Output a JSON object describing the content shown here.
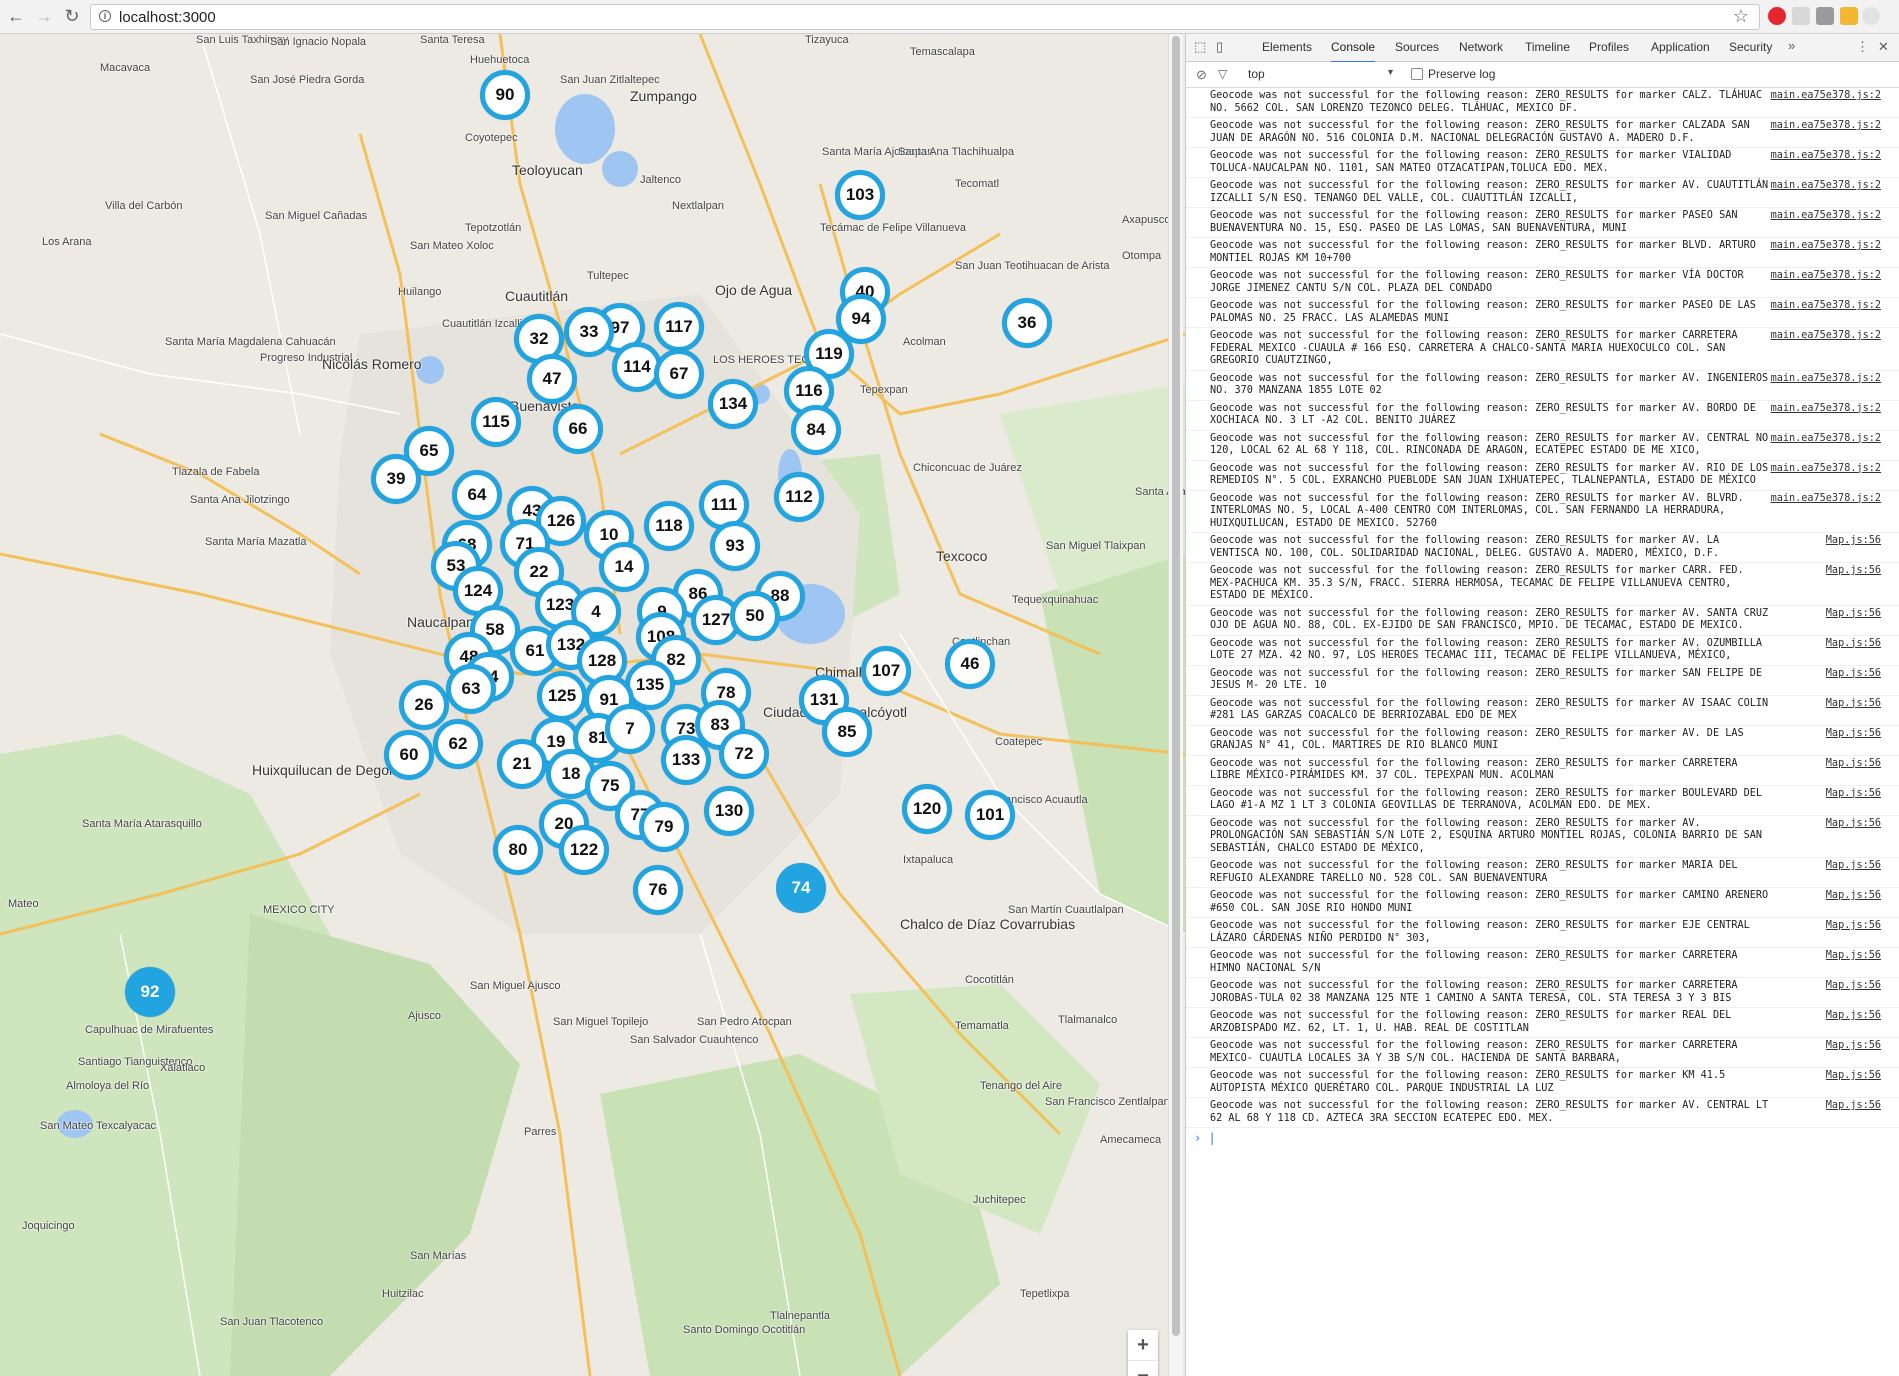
{
  "browser": {
    "url": "localhost:3000",
    "back_icon": "←",
    "forward_icon": "→",
    "reload_icon": "↻",
    "info_icon": "i",
    "star_icon": "☆"
  },
  "map": {
    "places": [
      {
        "t": "Santa Teresa"
      },
      {
        "t": "San Luis Taxhimay"
      },
      {
        "t": "San Ignacio Nopala"
      },
      {
        "t": "Huehuetoca"
      },
      {
        "t": "Tizayuca"
      },
      {
        "t": "Temascalapa"
      },
      {
        "t": "Macavaca"
      },
      {
        "t": "San José Piedra Gorda"
      },
      {
        "t": "San Juan Zitlaltepec"
      },
      {
        "t": "Zumpango"
      },
      {
        "t": "Coyotepec"
      },
      {
        "t": "Teoloyucan"
      },
      {
        "t": "Jaltenco"
      },
      {
        "t": "Nextlalpan"
      },
      {
        "t": "Santa María Ajoloapan"
      },
      {
        "t": "Santa Ana Tlachihualpa"
      },
      {
        "t": "Tecomatl"
      },
      {
        "t": "Villa del Carbón"
      },
      {
        "t": "San Miguel Cañadas"
      },
      {
        "t": "Tepotzotlán"
      },
      {
        "t": "Tecámac de Felipe Villanueva"
      },
      {
        "t": "Los Arana"
      },
      {
        "t": "San Mateo Xoloc"
      },
      {
        "t": "Tultepec"
      },
      {
        "t": "Ojo de Agua"
      },
      {
        "t": "San Juan Teotihuacan de Arista"
      },
      {
        "t": "Huilango"
      },
      {
        "t": "Cuautitlán"
      },
      {
        "t": "Cuautitlán Izcalli"
      },
      {
        "t": "LOS HEROES TECAMAC"
      },
      {
        "t": "Acolman"
      },
      {
        "t": "Santa María Magdalena Cahuacán"
      },
      {
        "t": "Progreso Industrial"
      },
      {
        "t": "Nicolás Romero"
      },
      {
        "t": "Buenavista"
      },
      {
        "t": "Tepexpan"
      },
      {
        "t": "Chiconcuac de Juárez"
      },
      {
        "t": "Tlazala de Fabela"
      },
      {
        "t": "Santa Ana Jilotzingo"
      },
      {
        "t": "Santa María Mazatla"
      },
      {
        "t": "Texcoco"
      },
      {
        "t": "San Miguel Tlaixpan"
      },
      {
        "t": "Tequexquinahuac"
      },
      {
        "t": "Naucalpan"
      },
      {
        "t": "Coatlinchan"
      },
      {
        "t": "Chimalhuacan"
      },
      {
        "t": "Ciudad Nezahualcóyotl"
      },
      {
        "t": "Coatepec"
      },
      {
        "t": "Huixquilucan de Degollado"
      },
      {
        "t": "San Francisco Acuautla"
      },
      {
        "t": "Santa María Atarasquillo"
      },
      {
        "t": "Ixtapaluca"
      },
      {
        "t": "Chalco de Díaz Covarrubias"
      },
      {
        "t": "San Martín Cuautlalpan"
      },
      {
        "t": "Cocotitlán"
      },
      {
        "t": "San Miguel Ajusco"
      },
      {
        "t": "Ajusco"
      },
      {
        "t": "San Miguel Topilejo"
      },
      {
        "t": "San Pedro Atocpan"
      },
      {
        "t": "San Salvador Cuauhtenco"
      },
      {
        "t": "Temamatla"
      },
      {
        "t": "Tlalmanalco"
      },
      {
        "t": "Capulhuac de Mirafuentes"
      },
      {
        "t": "Santiago Tianguistenco"
      },
      {
        "t": "Xalatlaco"
      },
      {
        "t": "Almoloya del Río"
      },
      {
        "t": "San Mateo Texcalyacac"
      },
      {
        "t": "Tenango del Aire"
      },
      {
        "t": "San Francisco Zentlalpan"
      },
      {
        "t": "Amecameca"
      },
      {
        "t": "Parres"
      },
      {
        "t": "Juchitepec"
      },
      {
        "t": "Joquicingo"
      },
      {
        "t": "San Marías"
      },
      {
        "t": "Huitzilac"
      },
      {
        "t": "Tlalnepantla"
      },
      {
        "t": "San Juan Tlacotenco"
      },
      {
        "t": "Santo Domingo Ocotitlán"
      },
      {
        "t": "Tepetlixpa"
      },
      {
        "t": "MEXICO CITY"
      },
      {
        "t": "Mateo"
      },
      {
        "t": "Santa Ana Apipil"
      },
      {
        "t": "Axapusco"
      },
      {
        "t": "Otompa"
      }
    ],
    "clusters": [
      {
        "n": "90"
      },
      {
        "n": "103"
      },
      {
        "n": "40"
      },
      {
        "n": "94"
      },
      {
        "n": "36"
      },
      {
        "n": "32"
      },
      {
        "n": "97"
      },
      {
        "n": "33"
      },
      {
        "n": "117"
      },
      {
        "n": "119"
      },
      {
        "n": "47"
      },
      {
        "n": "114"
      },
      {
        "n": "67"
      },
      {
        "n": "116"
      },
      {
        "n": "134"
      },
      {
        "n": "84"
      },
      {
        "n": "115"
      },
      {
        "n": "66"
      },
      {
        "n": "65"
      },
      {
        "n": "39"
      },
      {
        "n": "64"
      },
      {
        "n": "43"
      },
      {
        "n": "126"
      },
      {
        "n": "112"
      },
      {
        "n": "111"
      },
      {
        "n": "118"
      },
      {
        "n": "10"
      },
      {
        "n": "93"
      },
      {
        "n": "68"
      },
      {
        "n": "71"
      },
      {
        "n": "53"
      },
      {
        "n": "22"
      },
      {
        "n": "14"
      },
      {
        "n": "124"
      },
      {
        "n": "123"
      },
      {
        "n": "86"
      },
      {
        "n": "88"
      },
      {
        "n": "4"
      },
      {
        "n": "9"
      },
      {
        "n": "127"
      },
      {
        "n": "50"
      },
      {
        "n": "58"
      },
      {
        "n": "108"
      },
      {
        "n": "61"
      },
      {
        "n": "132"
      },
      {
        "n": "48"
      },
      {
        "n": "128"
      },
      {
        "n": "82"
      },
      {
        "n": "107"
      },
      {
        "n": "46"
      },
      {
        "n": "54"
      },
      {
        "n": "135"
      },
      {
        "n": "63"
      },
      {
        "n": "125"
      },
      {
        "n": "91"
      },
      {
        "n": "78"
      },
      {
        "n": "131"
      },
      {
        "n": "26"
      },
      {
        "n": "73"
      },
      {
        "n": "83"
      },
      {
        "n": "85"
      },
      {
        "n": "62"
      },
      {
        "n": "19"
      },
      {
        "n": "81"
      },
      {
        "n": "7"
      },
      {
        "n": "60"
      },
      {
        "n": "72"
      },
      {
        "n": "133"
      },
      {
        "n": "21"
      },
      {
        "n": "18"
      },
      {
        "n": "75"
      },
      {
        "n": "120"
      },
      {
        "n": "101"
      },
      {
        "n": "130"
      },
      {
        "n": "77"
      },
      {
        "n": "79"
      },
      {
        "n": "20"
      },
      {
        "n": "122"
      },
      {
        "n": "80"
      },
      {
        "n": "76"
      },
      {
        "n": "74"
      },
      {
        "n": "92"
      }
    ],
    "zoom_in": "+",
    "zoom_out": "−"
  },
  "devtools": {
    "tabs": [
      "Elements",
      "Console",
      "Sources",
      "Network",
      "Timeline",
      "Profiles",
      "Application",
      "Security"
    ],
    "more_icon": "»",
    "menu_icon": "⋮",
    "close_icon": "✕",
    "context": "top",
    "preserve_log": "Preserve log",
    "logs": [
      {
        "msg": "Geocode was not successful for the following reason: ZERO_RESULTS for marker CALZ. TLÁHUAC NO. 5662  COL. SAN LORENZO TEZONCO  DELEG. TLÁHUAC, MEXICO DF.",
        "src": "main.ea75e378.js:2"
      },
      {
        "msg": "Geocode was not successful for the following reason: ZERO_RESULTS for marker CALZADA SAN JUAN DE ARAGÓN NO. 516 COLONIA D.M. NACIONAL DELEGRACIÓN GUSTAVO A. MADERO D.F.",
        "src": "main.ea75e378.js:2"
      },
      {
        "msg": "Geocode was not successful for the following reason: ZERO_RESULTS for marker VIALIDAD TOLUCA-NAUCALPAN NO. 1101, SAN MATEO OTZACATIPAN,TOLUCA EDO. MEX.",
        "src": "main.ea75e378.js:2"
      },
      {
        "msg": "Geocode was not successful for the following reason: ZERO_RESULTS for marker AV. CUAUTITLÁN IZCALLI S/N ESQ. TENANGO DEL VALLE, COL. CUAUTITLÁN IZCALLI,",
        "src": "main.ea75e378.js:2"
      },
      {
        "msg": "Geocode was not successful for the following reason: ZERO_RESULTS for marker PASEO SAN BUENAVENTURA NO. 15, ESQ. PASEO DE LAS LOMAS, SAN BUENAVENTURA, MUNI",
        "src": "main.ea75e378.js:2"
      },
      {
        "msg": "Geocode was not successful for the following reason: ZERO_RESULTS for marker BLVD. ARTURO MONTIEL ROJAS KM 10+700",
        "src": "main.ea75e378.js:2"
      },
      {
        "msg": "Geocode was not successful for the following reason: ZERO_RESULTS for marker VÍA DOCTOR JORGE JIMENEZ CANTU S/N COL. PLAZA DEL CONDADO",
        "src": "main.ea75e378.js:2"
      },
      {
        "msg": "Geocode was not successful for the following reason: ZERO_RESULTS for marker PASEO DE LAS PALOMAS NO. 25 FRACC. LAS ALAMEDAS MUNI",
        "src": "main.ea75e378.js:2"
      },
      {
        "msg": "Geocode was not successful for the following reason: ZERO_RESULTS for marker CARRETERA FEDERAL MEXICO -CUAULA # 166 ESQ. CARRETERA A CHALCO-SANTA MARIA HUEXOCULCO COL. SAN GREGORIO CUAUTZINGO,",
        "src": "main.ea75e378.js:2"
      },
      {
        "msg": "Geocode was not successful for the following reason: ZERO_RESULTS for marker AV. INGENIEROS NO. 370 MANZANA 1855 LOTE 02",
        "src": "main.ea75e378.js:2"
      },
      {
        "msg": "Geocode was not successful for the following reason: ZERO_RESULTS for marker AV. BORDO DE XOCHIACA NO. 3 LT -A2  COL. BENITO JUÁREZ",
        "src": "main.ea75e378.js:2"
      },
      {
        "msg": "Geocode was not successful for the following reason: ZERO_RESULTS for marker AV. CENTRAL NO 120, LOCAL 62 AL 68 Y 118, COL. RINCONADA DE ARAGON, ECATEPEC ESTADO DE ME XICO,",
        "src": "main.ea75e378.js:2"
      },
      {
        "msg": "Geocode was not successful for the following reason: ZERO_RESULTS for marker AV. RIO DE LOS REMEDIOS N°. 5 COL. EXRANCHO PUEBLODE SAN JUAN IXHUATEPEC, TLALNEPANTLA, ESTADO DE MÉXICO",
        "src": "main.ea75e378.js:2"
      },
      {
        "msg": "Geocode was not successful for the following reason: ZERO_RESULTS for marker AV. BLVRD. INTERLOMAS NO. 5, LOCAL A-400 CENTRO COM INTERLOMAS, COL. SAN FERNANDO LA HERRADURA, HUIXQUILUCAN, ESTADO DE MEXICO. 52760",
        "src": "main.ea75e378.js:2"
      },
      {
        "msg": "Geocode was not successful for the following reason: ZERO_RESULTS for marker AV. LA VENTISCA NO. 100, COL. SOLIDARIDAD NACIONAL, DELEG. GUSTAVO A. MADERO, MÉXICO, D.F.",
        "src": "Map.js:56"
      },
      {
        "msg": "Geocode was not successful for the following reason: ZERO_RESULTS for marker CARR. FED. MEX-PACHUCA KM. 35.3 S/N, FRACC. SIERRA HERMOSA, TECAMAC DE FELIPE VILLANUEVA CENTRO, ESTADO DE MÉXICO.",
        "src": "Map.js:56"
      },
      {
        "msg": "Geocode was not successful for the following reason: ZERO_RESULTS for marker AV. SANTA CRUZ OJO DE AGUA NO. 88, COL. EX-EJIDO DE SAN FRANCISCO, MPIO. DE TECAMAC, ESTADO DE MEXICO.",
        "src": "Map.js:56"
      },
      {
        "msg": "Geocode was not successful for the following reason: ZERO_RESULTS for marker AV. OZUMBILLA LOTE 27 MZA. 42 NO. 97, LOS HEROES TECAMAC III, TECAMAC DE FELIPE VILLANUEVA, MÉXICO,",
        "src": "Map.js:56"
      },
      {
        "msg": "Geocode was not successful for the following reason: ZERO_RESULTS for marker SAN FELIPE DE JESUS M- 20 LTE. 10",
        "src": "Map.js:56"
      },
      {
        "msg": "Geocode was not successful for the following reason: ZERO_RESULTS for marker AV ISAAC COLIN #281 LAS GARZAS COACALCO DE BERRIOZABAL EDO DE MEX",
        "src": "Map.js:56"
      },
      {
        "msg": "Geocode was not successful for the following reason: ZERO_RESULTS for marker AV. DE LAS GRANJAS N° 41,  COL. MARTIRES DE RIO BLANCO MUNI",
        "src": "Map.js:56"
      },
      {
        "msg": "Geocode was not successful for the following reason: ZERO_RESULTS for marker CARRETERA LIBRE MÉXICO-PIRÁMIDES KM. 37 COL. TEPEXPAN MUN. ACOLMAN",
        "src": "Map.js:56"
      },
      {
        "msg": "Geocode was not successful for the following reason: ZERO_RESULTS for marker BOULEVARD DEL LAGO #1-A MZ 1 LT 3 COLONIA GEOVILLAS DE TERRANOVA,  ACOLMAN EDO. DE MEX.",
        "src": "Map.js:56"
      },
      {
        "msg": "Geocode was not successful for the following reason: ZERO_RESULTS for marker AV. PROLONGACIÓN SAN SEBASTIÁN S/N LOTE 2, ESQUINA ARTURO MONTIEL ROJAS, COLONIA BARRIO DE SAN SEBASTIÁN, CHALCO ESTADO DE MÉXICO,",
        "src": "Map.js:56"
      },
      {
        "msg": "Geocode was not successful for the following reason: ZERO_RESULTS for marker MARIA DEL REFUGIO ALEXANDRE TARELLO NO. 528 COL. SAN BUENAVENTURA",
        "src": "Map.js:56"
      },
      {
        "msg": "Geocode was not successful for the following reason: ZERO_RESULTS for marker CAMINO ARENERO #650 COL. SAN JOSE RIO HONDO MUNI",
        "src": "Map.js:56"
      },
      {
        "msg": "Geocode was not successful for the following reason: ZERO_RESULTS for marker EJE CENTRAL LÁZARO CÁRDENAS NIÑO PERDIDO N° 303,",
        "src": "Map.js:56"
      },
      {
        "msg": "Geocode was not successful for the following reason: ZERO_RESULTS for marker CARRETERA HIMNO NACIONAL S/N",
        "src": "Map.js:56"
      },
      {
        "msg": "Geocode was not successful for the following reason: ZERO_RESULTS for marker CARRETERA JOROBAS-TULA 02 38 MANZANA 125 NTE 1 CAMINO A SANTA TERESA, COL. STA TERESA 3 Y 3 BIS",
        "src": "Map.js:56"
      },
      {
        "msg": "Geocode was not successful for the following reason: ZERO_RESULTS for marker REAL DEL ARZOBISPADO MZ. 62, LT. 1, U. HAB. REAL DE COSTITLAN",
        "src": "Map.js:56"
      },
      {
        "msg": "Geocode was not successful for the following reason: ZERO_RESULTS for marker CARRETERA MEXICO- CUAUTLA LOCALES 3A Y 3B S/N COL. HACIENDA DE SANTA BARBARA,",
        "src": "Map.js:56"
      },
      {
        "msg": "Geocode was not successful for the following reason: ZERO_RESULTS for marker KM 41.5 AUTOPISTA MÉXICO QUERÉTARO COL. PARQUE INDUSTRIAL LA LUZ",
        "src": "Map.js:56"
      },
      {
        "msg": "Geocode was not successful for the following reason: ZERO_RESULTS for marker AV. CENTRAL LT 62 AL 68 Y 118 CD. AZTECA 3RA SECCION ECATEPEC EDO. MEX.",
        "src": "Map.js:56"
      }
    ],
    "prompt_icon": "›"
  }
}
